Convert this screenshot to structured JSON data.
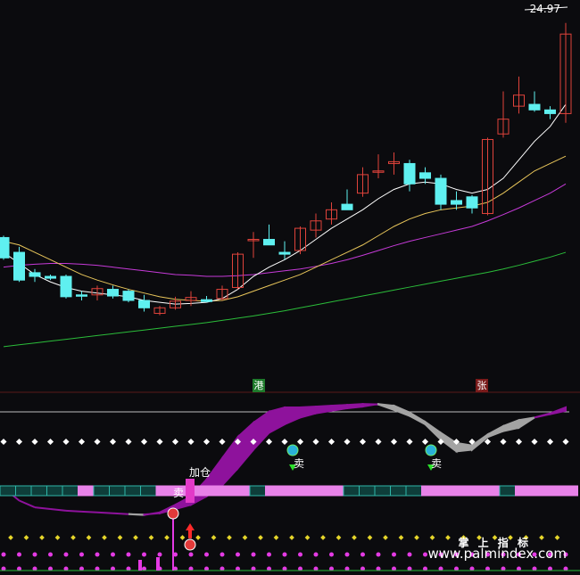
{
  "price_label": "24.97",
  "tags": {
    "gang": "港",
    "zhang": "张"
  },
  "signals": {
    "add": "加仓",
    "sell": "卖"
  },
  "brand": "掌 上 指 标",
  "watermark": "www.palmindex.com",
  "colors": {
    "background": "#0b0b0e",
    "up": "#e0433b",
    "down": "#5ff0f0",
    "ma5": "#ffffff",
    "ma10": "#e8c55a",
    "ma30": "#c63ad8",
    "ma60": "#2bbd3a",
    "ribbon_bull": "#8e129c",
    "ribbon_bear": "#a3a3a3",
    "band_pink": "#e882e8",
    "band_teal": "#0e3e3a"
  },
  "chart_data": {
    "type": "candlestick",
    "candles": [
      {
        "o": 18.0,
        "h": 18.05,
        "l": 17.4,
        "c": 17.45
      },
      {
        "o": 17.6,
        "h": 17.75,
        "l": 16.8,
        "c": 16.85
      },
      {
        "o": 17.05,
        "h": 17.15,
        "l": 16.8,
        "c": 16.95
      },
      {
        "o": 16.95,
        "h": 17.0,
        "l": 16.85,
        "c": 16.9
      },
      {
        "o": 16.95,
        "h": 17.0,
        "l": 16.35,
        "c": 16.4
      },
      {
        "o": 16.45,
        "h": 16.55,
        "l": 16.3,
        "c": 16.42
      },
      {
        "o": 16.45,
        "h": 16.7,
        "l": 16.3,
        "c": 16.62
      },
      {
        "o": 16.6,
        "h": 16.7,
        "l": 16.35,
        "c": 16.42
      },
      {
        "o": 16.55,
        "h": 16.6,
        "l": 16.25,
        "c": 16.3
      },
      {
        "o": 16.3,
        "h": 16.45,
        "l": 16.0,
        "c": 16.1
      },
      {
        "o": 15.95,
        "h": 16.15,
        "l": 15.9,
        "c": 16.1
      },
      {
        "o": 16.1,
        "h": 16.4,
        "l": 16.05,
        "c": 16.28
      },
      {
        "o": 16.3,
        "h": 16.55,
        "l": 16.15,
        "c": 16.38
      },
      {
        "o": 16.32,
        "h": 16.42,
        "l": 16.25,
        "c": 16.27
      },
      {
        "o": 16.35,
        "h": 16.7,
        "l": 16.3,
        "c": 16.6
      },
      {
        "o": 16.65,
        "h": 17.6,
        "l": 16.6,
        "c": 17.55
      },
      {
        "o": 17.95,
        "h": 18.15,
        "l": 17.45,
        "c": 17.95
      },
      {
        "o": 17.95,
        "h": 18.35,
        "l": 17.8,
        "c": 17.8
      },
      {
        "o": 17.6,
        "h": 17.9,
        "l": 17.4,
        "c": 17.55
      },
      {
        "o": 17.65,
        "h": 18.3,
        "l": 17.55,
        "c": 18.25
      },
      {
        "o": 18.2,
        "h": 18.65,
        "l": 18.0,
        "c": 18.45
      },
      {
        "o": 18.5,
        "h": 18.95,
        "l": 18.35,
        "c": 18.75
      },
      {
        "o": 18.9,
        "h": 19.3,
        "l": 18.75,
        "c": 18.75
      },
      {
        "o": 19.2,
        "h": 19.9,
        "l": 19.1,
        "c": 19.7
      },
      {
        "o": 19.8,
        "h": 20.25,
        "l": 19.6,
        "c": 19.8
      },
      {
        "o": 20.0,
        "h": 20.3,
        "l": 19.7,
        "c": 20.05
      },
      {
        "o": 20.0,
        "h": 20.1,
        "l": 19.25,
        "c": 19.45
      },
      {
        "o": 19.75,
        "h": 19.9,
        "l": 19.45,
        "c": 19.6
      },
      {
        "o": 19.6,
        "h": 19.7,
        "l": 18.75,
        "c": 18.9
      },
      {
        "o": 19.0,
        "h": 19.25,
        "l": 18.75,
        "c": 18.9
      },
      {
        "o": 19.1,
        "h": 19.15,
        "l": 18.65,
        "c": 18.8
      },
      {
        "o": 18.65,
        "h": 20.7,
        "l": 18.6,
        "c": 20.65
      },
      {
        "o": 20.8,
        "h": 21.95,
        "l": 20.7,
        "c": 21.2
      },
      {
        "o": 21.55,
        "h": 22.35,
        "l": 21.35,
        "c": 21.85
      },
      {
        "o": 21.6,
        "h": 21.95,
        "l": 21.4,
        "c": 21.45
      },
      {
        "o": 21.45,
        "h": 21.55,
        "l": 21.2,
        "c": 21.35
      },
      {
        "o": 21.35,
        "h": 23.8,
        "l": 21.1,
        "c": 23.5
      }
    ],
    "ma5": [
      17.6,
      17.3,
      17.0,
      16.8,
      16.65,
      16.55,
      16.5,
      16.45,
      16.4,
      16.3,
      16.25,
      16.2,
      16.22,
      16.25,
      16.35,
      16.6,
      16.95,
      17.2,
      17.4,
      17.65,
      17.95,
      18.25,
      18.5,
      18.75,
      19.05,
      19.3,
      19.45,
      19.5,
      19.45,
      19.3,
      19.2,
      19.3,
      19.6,
      20.1,
      20.6,
      21.0,
      21.6
    ],
    "ma10": [
      17.9,
      17.8,
      17.6,
      17.4,
      17.2,
      17.0,
      16.85,
      16.72,
      16.6,
      16.5,
      16.4,
      16.33,
      16.3,
      16.28,
      16.3,
      16.4,
      16.55,
      16.7,
      16.85,
      17.0,
      17.2,
      17.4,
      17.6,
      17.8,
      18.05,
      18.3,
      18.5,
      18.65,
      18.75,
      18.8,
      18.85,
      18.95,
      19.2,
      19.5,
      19.8,
      20.0,
      20.2
    ],
    "ma30": [
      17.2,
      17.25,
      17.28,
      17.3,
      17.3,
      17.28,
      17.25,
      17.2,
      17.15,
      17.1,
      17.05,
      17.0,
      16.98,
      16.95,
      16.95,
      16.97,
      17.0,
      17.05,
      17.1,
      17.15,
      17.22,
      17.3,
      17.4,
      17.52,
      17.65,
      17.78,
      17.9,
      18.0,
      18.1,
      18.2,
      18.3,
      18.45,
      18.62,
      18.8,
      19.0,
      19.2,
      19.45
    ],
    "ma60": [
      15.05,
      15.1,
      15.15,
      15.2,
      15.25,
      15.3,
      15.35,
      15.4,
      15.45,
      15.5,
      15.55,
      15.6,
      15.65,
      15.7,
      15.76,
      15.82,
      15.88,
      15.95,
      16.02,
      16.1,
      16.18,
      16.26,
      16.34,
      16.42,
      16.5,
      16.58,
      16.66,
      16.74,
      16.82,
      16.9,
      16.98,
      17.06,
      17.15,
      17.25,
      17.36,
      17.47,
      17.6
    ],
    "price_range": [
      14.3,
      24.3
    ],
    "indicator_ribbon": [
      {
        "a": -5.5,
        "b": -5.5
      },
      {
        "a": -7.0,
        "b": -7.0
      },
      {
        "a": -7.8,
        "b": -7.8
      },
      {
        "a": -8.0,
        "b": -8.0
      },
      {
        "a": -8.2,
        "b": -8.2
      },
      {
        "a": -8.3,
        "b": -8.3
      },
      {
        "a": -8.4,
        "b": -8.4
      },
      {
        "a": -8.5,
        "b": -8.5
      },
      {
        "a": -8.6,
        "b": -8.6
      },
      {
        "a": -8.65,
        "b": -8.7
      },
      {
        "a": -8.5,
        "b": -8.4
      },
      {
        "a": -8.0,
        "b": -7.5
      },
      {
        "a": -7.5,
        "b": -6.5
      },
      {
        "a": -6.5,
        "b": -4.5
      },
      {
        "a": -5.2,
        "b": -2.0
      },
      {
        "a": -3.2,
        "b": 0.5
      },
      {
        "a": -1.0,
        "b": 2.2
      },
      {
        "a": 1.0,
        "b": 3.5
      },
      {
        "a": 2.0,
        "b": 4.0
      },
      {
        "a": 2.8,
        "b": 4.0
      },
      {
        "a": 3.3,
        "b": 4.1
      },
      {
        "a": 3.6,
        "b": 4.2
      },
      {
        "a": 3.9,
        "b": 4.3
      },
      {
        "a": 4.1,
        "b": 4.4
      },
      {
        "a": 4.4,
        "b": 4.35
      },
      {
        "a": 4.2,
        "b": 3.7
      },
      {
        "a": 3.4,
        "b": 3.0
      },
      {
        "a": 2.3,
        "b": 2.0
      },
      {
        "a": 1.0,
        "b": 0.2
      },
      {
        "a": -0.2,
        "b": -1.2
      },
      {
        "a": -0.5,
        "b": -1.0
      },
      {
        "a": 0.8,
        "b": 0.5
      },
      {
        "a": 1.8,
        "b": 1.2
      },
      {
        "a": 2.5,
        "b": 1.6
      },
      {
        "a": 2.8,
        "b": 2.8
      },
      {
        "a": 3.2,
        "b": 3.3
      },
      {
        "a": 3.6,
        "b": 4.0
      }
    ],
    "band": [
      "t",
      "t",
      "t",
      "t",
      "t",
      "p",
      "t",
      "t",
      "t",
      "t",
      "p",
      "p",
      "p",
      "p",
      "p",
      "p",
      "t",
      "p",
      "p",
      "p",
      "p",
      "p",
      "t",
      "t",
      "t",
      "t",
      "t",
      "p",
      "p",
      "p",
      "p",
      "p",
      "t",
      "p",
      "p",
      "p",
      "p"
    ],
    "markers": [
      {
        "i": 8,
        "kind": "pink_bar"
      },
      {
        "i": 9,
        "kind": "pink_bar"
      },
      {
        "i": 10,
        "kind": "buy_ball"
      },
      {
        "i": 11,
        "kind": "buy_ball"
      }
    ]
  }
}
